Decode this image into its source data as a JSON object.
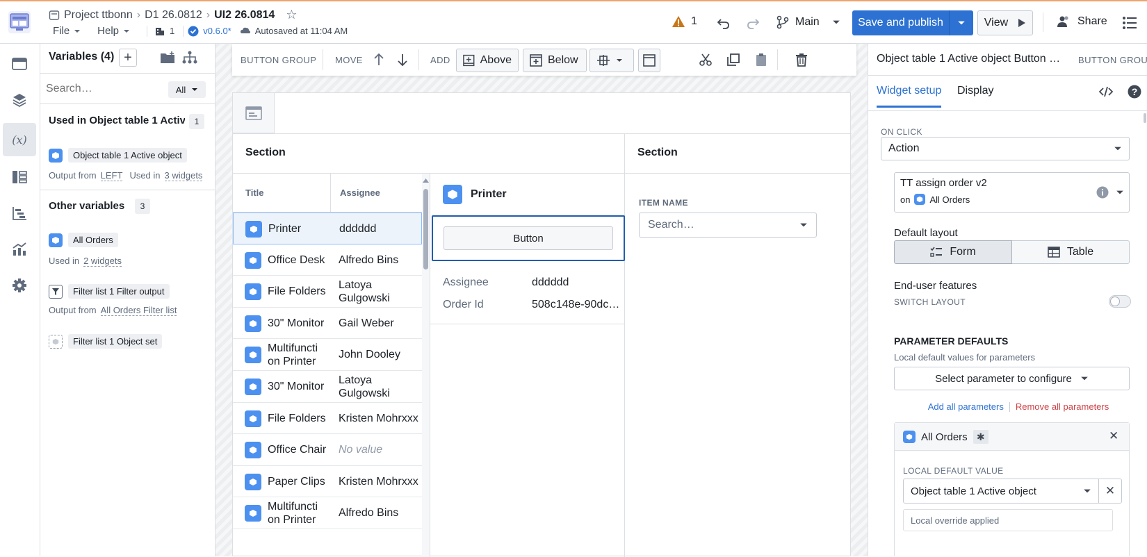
{
  "header": {
    "project": "Project ttbonn",
    "folder": "D1 26.0812",
    "page": "UI2 26.0814",
    "menu_file": "File",
    "menu_help": "Help",
    "building_count": "1",
    "version": "v0.6.0*",
    "autosave": "Autosaved at 11:04 AM",
    "warning_count": "1",
    "branch": "Main",
    "save_publish": "Save and publish",
    "view": "View",
    "share": "Share"
  },
  "variables": {
    "title": "Variables (4)",
    "search_placeholder": "Search…",
    "filter": "All",
    "used_title": "Used in Object table 1 Activ…",
    "used_count": "1",
    "active_object": "Object table 1 Active object",
    "output_from": "Output from",
    "left": "LEFT",
    "used_in": "Used in",
    "three_widgets": "3 widgets",
    "other_title": "Other variables",
    "other_count": "3",
    "all_orders": "All Orders",
    "two_widgets": "2 widgets",
    "filter_output": "Filter list 1 Filter output",
    "filter_source": "All Orders Filter list",
    "object_set": "Filter list 1 Object set"
  },
  "toolbar": {
    "group": "BUTTON GROUP",
    "move": "MOVE",
    "add": "ADD",
    "above": "Above",
    "below": "Below"
  },
  "canvas": {
    "section_left": "Section",
    "section_right": "Section",
    "col_title": "Title",
    "col_assignee": "Assignee",
    "rows": [
      {
        "title": "Printer",
        "assignee": "dddddd"
      },
      {
        "title": "Office Desk",
        "assignee": "Alfredo Bins"
      },
      {
        "title": "File Folders",
        "assignee": "Latoya Gulgowski"
      },
      {
        "title": "30\" Monitor",
        "assignee": "Gail Weber"
      },
      {
        "title": "Multifuncti on Printer",
        "assignee": "John Dooley"
      },
      {
        "title": "30\" Monitor",
        "assignee": "Latoya Gulgowski"
      },
      {
        "title": "File Folders",
        "assignee": "Kristen Mohrxxx"
      },
      {
        "title": "Office Chair",
        "assignee": "No value"
      },
      {
        "title": "Paper Clips",
        "assignee": "Kristen Mohrxxx"
      },
      {
        "title": "Multifuncti on Printer",
        "assignee": "Alfredo Bins"
      }
    ],
    "detail_title": "Printer",
    "button": "Button",
    "prop_assignee_label": "Assignee",
    "prop_assignee_value": "dddddd",
    "prop_order_label": "Order Id",
    "prop_order_value": "508c148e-90dc…",
    "item_name": "ITEM NAME",
    "item_search": "Search…"
  },
  "right": {
    "title": "Object table 1 Active object Button …",
    "group": "BUTTON GROUP",
    "tab_setup": "Widget setup",
    "tab_display": "Display",
    "on_click": "ON CLICK",
    "action": "Action",
    "action_name": "TT assign order v2",
    "on": "on",
    "on_target": "All Orders",
    "default_layout": "Default layout",
    "form": "Form",
    "table": "Table",
    "end_user": "End-user features",
    "switch_layout": "SWITCH LAYOUT",
    "param_defaults": "PARAMETER DEFAULTS",
    "param_desc": "Local default values for parameters",
    "select_param": "Select parameter to configure",
    "add_all": "Add all parameters",
    "remove_all": "Remove all parameters",
    "param_name": "All Orders",
    "local_default": "LOCAL DEFAULT VALUE",
    "local_value": "Object table 1 Active object",
    "override": "Local override applied"
  },
  "colors": {
    "primary": "#2d72d2",
    "danger": "#cd4246",
    "warning": "#c87619",
    "cube": "#4c90f0"
  }
}
